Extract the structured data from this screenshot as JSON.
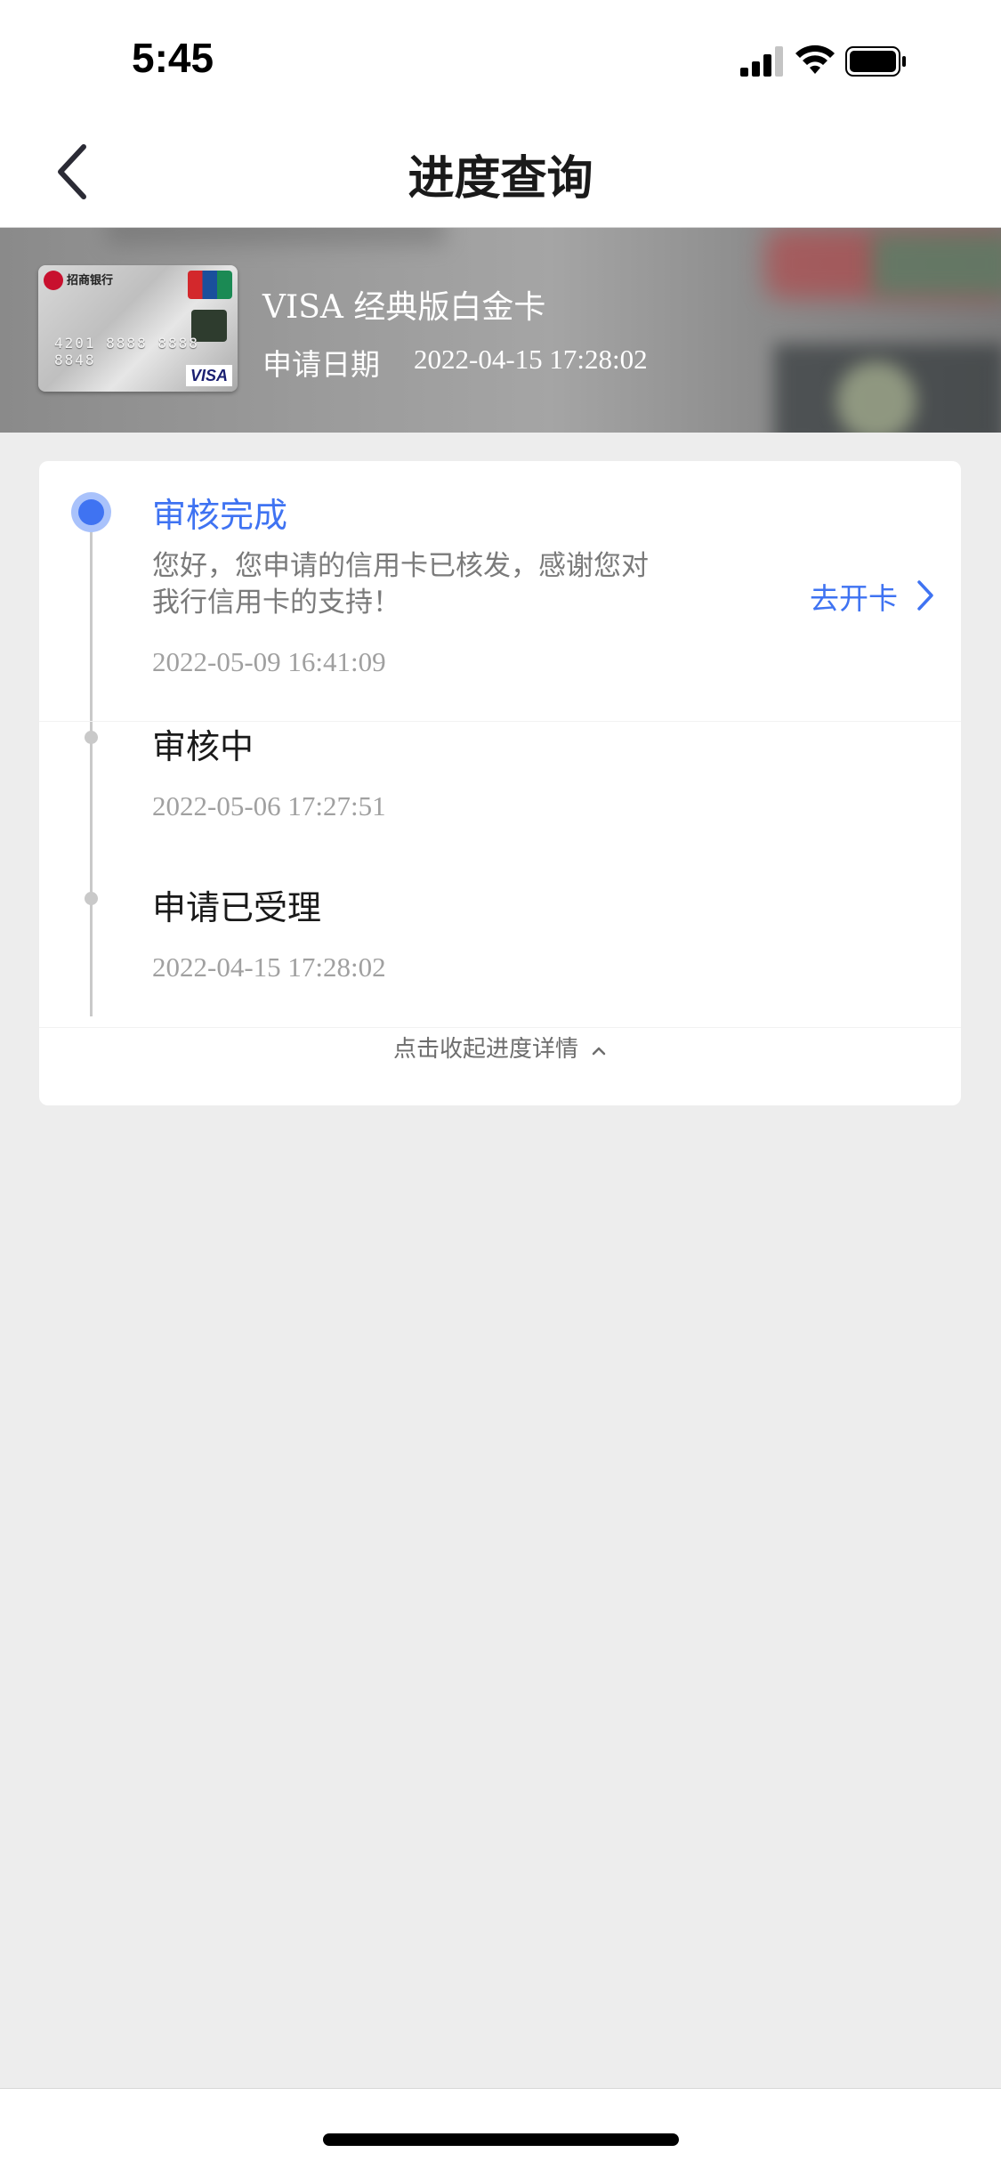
{
  "status_bar": {
    "time": "5:45"
  },
  "nav": {
    "title": "进度查询",
    "back_icon": "chevron-left-icon"
  },
  "card": {
    "name": "VISA 经典版白金卡",
    "apply_label": "申请日期",
    "apply_date": "2022-04-15 17:28:02",
    "thumbnail": {
      "bank": "招商银行",
      "number": "4201 8888 8888 8848",
      "network": "VISA"
    }
  },
  "progress": {
    "steps": [
      {
        "title": "审核完成",
        "description": "您好，您申请的信用卡已核发，感谢您对我行信用卡的支持！",
        "time": "2022-05-09 16:41:09",
        "active": true,
        "action_label": "去开卡"
      },
      {
        "title": "审核中",
        "time": "2022-05-06 17:27:51",
        "active": false
      },
      {
        "title": "申请已受理",
        "time": "2022-04-15 17:28:02",
        "active": false
      }
    ],
    "collapse_label": "点击收起进度详情"
  },
  "colors": {
    "accent": "#3f73f2",
    "background": "#ededed",
    "text_primary": "#1a1a1a",
    "text_secondary": "#7a7a7a"
  }
}
